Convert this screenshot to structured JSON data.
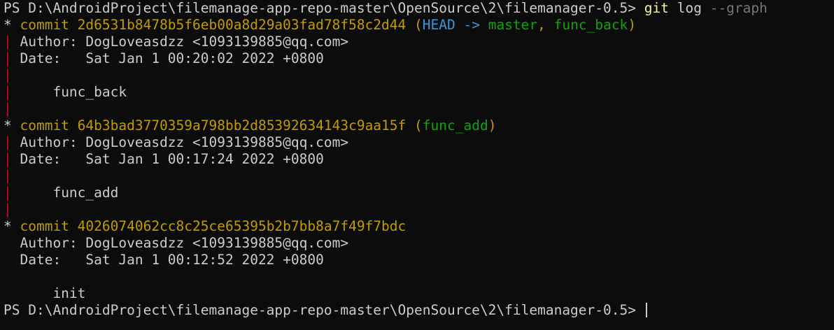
{
  "colors": {
    "background": "#0c0c0c",
    "text": "#cccccc",
    "commit_hash": "#c19c00",
    "head_ref": "#3a96dd",
    "branch_ref": "#13a10e",
    "graph_line": "#c50f1f",
    "command": "#f9f1a5"
  },
  "prompt": {
    "path_text": "PS D:\\AndroidProject\\filemanage-app-repo-master\\OpenSource\\2\\filemanager-0.5> ",
    "command": "git",
    "args": "log",
    "flag": "--graph"
  },
  "commits": [
    {
      "star": "* ",
      "commit_label": "commit ",
      "hash": "2d6531b8478b5f6eb00a8d29a03fad78f58c2d44",
      "refs_open": " (",
      "head": "HEAD",
      "arrow": " -> ",
      "branch1": "master",
      "comma": ", ",
      "branch2": "func_back",
      "refs_close": ")",
      "graph_bar": "|",
      "author_line": " Author: DogLoveasdzz <1093139885@qq.com>",
      "date_line": " Date:   Sat Jan 1 00:20:02 2022 +0800",
      "message_line": "     func_back"
    },
    {
      "star": "* ",
      "commit_label": "commit ",
      "hash": "64b3bad3770359a798bb2d85392634143c9aa15f",
      "refs_open": " (",
      "branch1": "func_add",
      "refs_close": ")",
      "graph_bar": "|",
      "author_line": " Author: DogLoveasdzz <1093139885@qq.com>",
      "date_line": " Date:   Sat Jan 1 00:17:24 2022 +0800",
      "message_line": "     func_add"
    },
    {
      "star": "* ",
      "commit_label": "commit ",
      "hash": "4026074062cc8c25ce65395b2b7bb8a7f49f7bdc",
      "author_line": "  Author: DogLoveasdzz <1093139885@qq.com>",
      "date_line": "  Date:   Sat Jan 1 00:12:52 2022 +0800",
      "message_line": "      init"
    }
  ],
  "final_prompt": {
    "path_text": "PS D:\\AndroidProject\\filemanage-app-repo-master\\OpenSource\\2\\filemanager-0.5> "
  }
}
